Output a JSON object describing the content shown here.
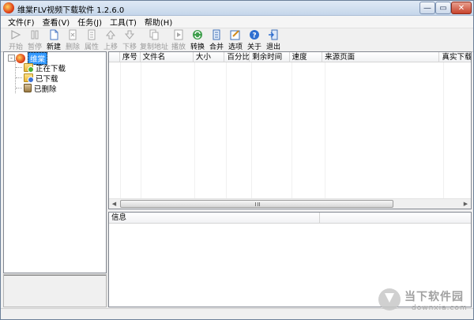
{
  "window": {
    "title": "维棠FLV视频下载软件 1.2.6.0",
    "controls": {
      "minimize": "—",
      "maximize": "▭",
      "close": "✕"
    }
  },
  "menu": [
    "文件(F)",
    "查看(V)",
    "任务(J)",
    "工具(T)",
    "帮助(H)"
  ],
  "toolbar": [
    {
      "label": "开始",
      "icon": "play-icon",
      "enabled": false
    },
    {
      "label": "暂停",
      "icon": "pause-icon",
      "enabled": false
    },
    {
      "label": "新建",
      "icon": "new-file-icon",
      "enabled": true
    },
    {
      "label": "删除",
      "icon": "delete-icon",
      "enabled": false
    },
    {
      "label": "属性",
      "icon": "properties-icon",
      "enabled": false
    },
    {
      "label": "上移",
      "icon": "move-up-icon",
      "enabled": false
    },
    {
      "label": "下移",
      "icon": "move-down-icon",
      "enabled": false
    },
    {
      "label": "复制地址",
      "icon": "copy-address-icon",
      "enabled": false
    },
    {
      "label": "播放",
      "icon": "media-play-icon",
      "enabled": false
    },
    {
      "label": "转换",
      "icon": "convert-icon",
      "enabled": true
    },
    {
      "label": "合并",
      "icon": "merge-icon",
      "enabled": true
    },
    {
      "label": "选项",
      "icon": "options-icon",
      "enabled": true
    },
    {
      "label": "关于",
      "icon": "about-icon",
      "enabled": true
    },
    {
      "label": "退出",
      "icon": "exit-icon",
      "enabled": true
    }
  ],
  "tree": {
    "root": {
      "label": "维棠",
      "expander": "-"
    },
    "children": [
      {
        "label": "正在下载",
        "icon": "downloading-folder-icon"
      },
      {
        "label": "已下载",
        "icon": "downloaded-folder-icon"
      },
      {
        "label": "已删除",
        "icon": "trash-icon"
      }
    ]
  },
  "list": {
    "columns": [
      "序号",
      "文件名",
      "大小",
      "百分比",
      "剩余时间",
      "速度",
      "来源页面",
      "真实下载"
    ],
    "rows": []
  },
  "info": {
    "columns": [
      "信息",
      ""
    ]
  },
  "watermark": {
    "text": "当下软件园",
    "url": "downxia.com"
  }
}
